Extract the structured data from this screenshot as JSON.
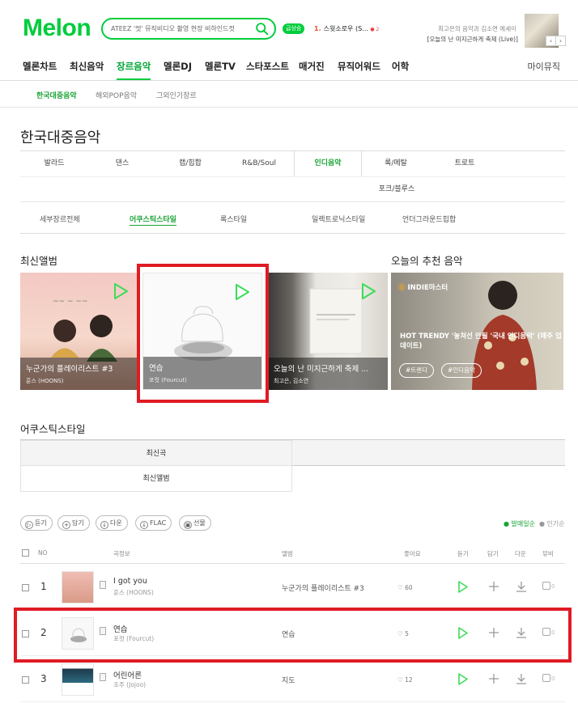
{
  "header": {
    "logo": "Melon",
    "search_value": "ATEEZ '멋' 뮤직비디오 촬영 현장 비하인드컷",
    "hot_badge": "급상승",
    "hot_rank_num": "1.",
    "hot_rank_text": "스윗소로우 (S...",
    "hot_rank_dot": "● 2",
    "promo_line1": "최고은의 음악과 김소연 에세이",
    "promo_line2": "[오늘의 난 미지근하게 축제 (Live)]",
    "promo_prev": "‹",
    "promo_next": "›"
  },
  "gnb": {
    "items": [
      "멜론차트",
      "최신음악",
      "장르음악",
      "멜론DJ",
      "멜론TV",
      "스타포스트",
      "매거진",
      "뮤직어워드",
      "어학"
    ],
    "active_index": 2,
    "mymusic": "마이뮤직"
  },
  "subnav": {
    "items": [
      "한국대중음악",
      "해외POP음악",
      "그외인기장르"
    ],
    "active_index": 0
  },
  "page_title": "한국대중음악",
  "genres": {
    "row1": [
      "발라드",
      "댄스",
      "랩/힙합",
      "R&B/Soul",
      "인디음악",
      "록/메탈",
      "트로트"
    ],
    "row2": [
      "포크/블루스"
    ],
    "active": "인디음악"
  },
  "styles": {
    "items": [
      "세부장르전체",
      "어쿠스틱스타일",
      "록스타일",
      "일렉트로닉스타일",
      "언더그라운드힙합"
    ],
    "active_index": 1
  },
  "latest_albums": {
    "title": "최신앨범",
    "cards": [
      {
        "title": "누군가의 플레이리스트 #3",
        "artist": "훈스 (HOONS)"
      },
      {
        "title": "연습",
        "artist": "포컷 (Fourcut)"
      },
      {
        "title": "오늘의 난 미지근하게 축제 ...",
        "artist": "최고은, 김소연"
      }
    ]
  },
  "recommend": {
    "title": "오늘의 추천 음악",
    "badge_pin": "⓪",
    "badge": "INDIE마스터",
    "headline": "HOT TRENDY '놓쳐선 안될 '국내 인디음악' (매주 업데이트)",
    "tags": [
      "#트렌디",
      "#인디음악"
    ]
  },
  "acoustic": {
    "title": "어쿠스틱스타일",
    "tabs": [
      "최신곡",
      "최신앨범"
    ]
  },
  "actions": {
    "buttons": [
      {
        "icon": "play-icon",
        "glyph": "▷",
        "label": "듣기"
      },
      {
        "icon": "plus-icon",
        "glyph": "+",
        "label": "담기"
      },
      {
        "icon": "download-icon",
        "glyph": "↓",
        "label": "다운"
      },
      {
        "icon": "flac-icon",
        "glyph": "↓",
        "label": "FLAC"
      },
      {
        "icon": "gift-icon",
        "glyph": "▣",
        "label": "선물"
      }
    ],
    "sort_on": "● 발매일순",
    "sort_off": "● 인기순"
  },
  "table": {
    "headers": {
      "no": "NO",
      "song": "곡정보",
      "album": "앨범",
      "likes": "좋아요",
      "listen": "듣기",
      "add": "담기",
      "download": "다운",
      "mv": "뮤비"
    },
    "rows": [
      {
        "rank": "1",
        "song": "I got you",
        "artist": "훈스 (HOONS)",
        "album": "누군가의 플레이리스트 #3",
        "likes": "♡ 60",
        "mv": "0"
      },
      {
        "rank": "2",
        "song": "연습",
        "artist": "포컷 (Fourcut)",
        "album": "연습",
        "likes": "♡ 5",
        "mv": "0"
      },
      {
        "rank": "3",
        "song": "어린어른",
        "artist": "조주 (Jojoo)",
        "album": "지도",
        "likes": "♡ 12",
        "mv": "0"
      }
    ]
  },
  "colors": {
    "brand": "#00cd3c",
    "highlight": "#e01b24"
  }
}
